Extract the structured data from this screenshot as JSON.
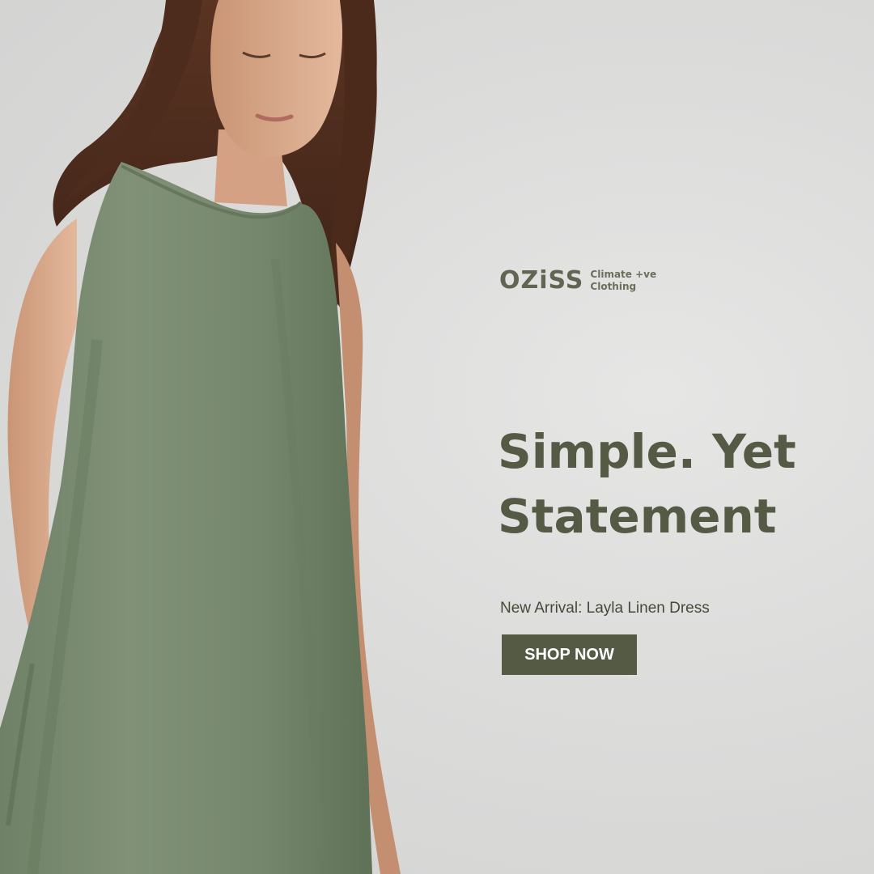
{
  "brand": {
    "name": "OZiSS",
    "tagline_line1": "Climate +ve",
    "tagline_line2": "Clothing"
  },
  "headline": {
    "line1": "Simple. Yet",
    "line2": "Statement"
  },
  "subline": "New Arrival: Layla Linen Dress",
  "cta_label": "SHOP NOW",
  "colors": {
    "background": "#dcdcdb",
    "olive_text": "#555a45",
    "dress_sage": "#7d8e73",
    "button_bg": "#555a45",
    "button_text": "#ffffff"
  }
}
